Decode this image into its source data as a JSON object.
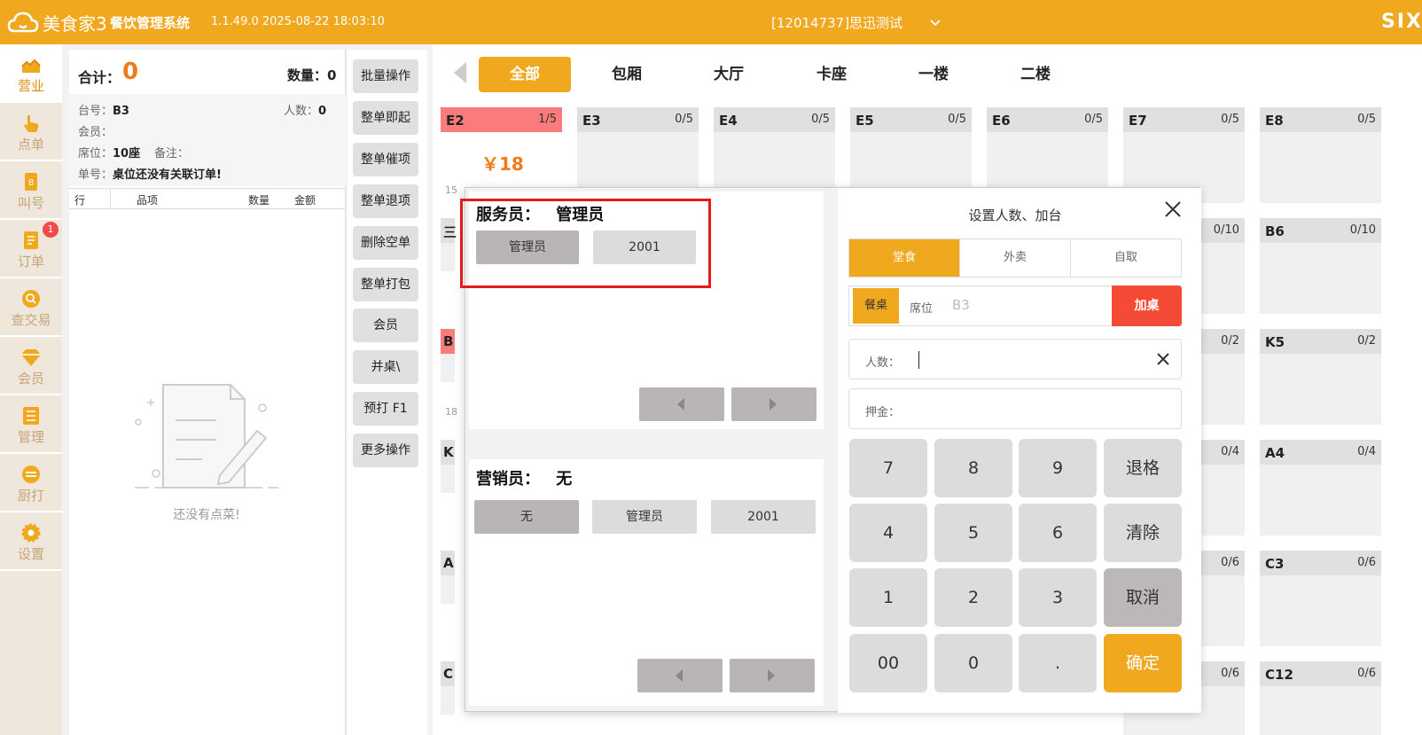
{
  "header": {
    "logo_text": "美食家3",
    "system_name": "餐饮管理系统",
    "version_time": "1.1.49.0 2025-08-22 18:03:10",
    "store": "[12014737]思迅测试",
    "brand": "SIX"
  },
  "nav": [
    {
      "label": "营业",
      "icon": "chart-icon"
    },
    {
      "label": "点单",
      "icon": "hand-icon"
    },
    {
      "label": "叫号",
      "icon": "number-icon"
    },
    {
      "label": "订单",
      "icon": "order-icon",
      "badge": "1"
    },
    {
      "label": "查交易",
      "icon": "search-icon"
    },
    {
      "label": "会员",
      "icon": "diamond-icon"
    },
    {
      "label": "管理",
      "icon": "list-icon"
    },
    {
      "label": "厨打",
      "icon": "kitchen-icon"
    },
    {
      "label": "设置",
      "icon": "gear-icon"
    }
  ],
  "order": {
    "total_label": "合计：",
    "total_value": "0",
    "qty_label": "数量：",
    "qty_value": "0",
    "table_label": "台号：",
    "table_value": "B3",
    "people_label": "人数：",
    "people_value": "0",
    "member_label": "会员：",
    "seat_label": "席位：",
    "seat_value": "10座",
    "remark_label": "备注：",
    "bill_label": "单号：",
    "bill_value": "桌位还没有关联订单!",
    "columns": [
      "行",
      "品项",
      "数量",
      "金额"
    ],
    "empty_text": "还没有点菜!"
  },
  "actions": [
    "批量操作",
    "整单即起",
    "整单催项",
    "整单退项",
    "删除空单",
    "整单打包",
    "会员",
    "并桌\\",
    "预打 F1",
    "更多操作"
  ],
  "areas": {
    "tabs": [
      "全部",
      "包厢",
      "大厅",
      "卡座",
      "一楼",
      "二楼"
    ],
    "active": "全部"
  },
  "tables": {
    "e2": {
      "name": "E2",
      "count": "1/5",
      "amount": "￥18"
    },
    "e3": {
      "name": "E3",
      "count": "0/5"
    },
    "e4": {
      "name": "E4",
      "count": "0/5"
    },
    "e5": {
      "name": "E5",
      "count": "0/5"
    },
    "e6": {
      "name": "E6",
      "count": "0/5"
    },
    "e7": {
      "name": "E7",
      "count": "0/5"
    },
    "e8": {
      "name": "E8",
      "count": "0/5"
    },
    "b6": {
      "name": "B6",
      "count": "0/10"
    },
    "k5": {
      "name": "K5",
      "count": "0/2"
    },
    "a4": {
      "name": "A4",
      "count": "0/4"
    },
    "c3": {
      "name": "C3",
      "count": "0/6"
    },
    "c12": {
      "name": "C12",
      "count": "0/6"
    },
    "col7_counts": [
      "0/10",
      "0/2",
      "0/4",
      "0/6",
      "0/6"
    ],
    "edge_labels": [
      "三",
      "B",
      "K",
      "A",
      "C"
    ],
    "edge_nums": [
      "15",
      "18"
    ]
  },
  "dialog": {
    "waiter_label": "服务员：",
    "waiter_value": "管理员",
    "waiter_options": [
      "管理员",
      "2001"
    ],
    "sales_label": "营销员：",
    "sales_value": "无",
    "sales_options": [
      "无",
      "管理员",
      "2001"
    ],
    "title": "设置人数、加台",
    "modes": [
      "堂食",
      "外卖",
      "自取"
    ],
    "seat_tag": "餐桌",
    "seat_label": "席位",
    "seat_value": "B3",
    "add_button": "加桌",
    "people_label": "人数：",
    "deposit_label": "押金：",
    "keys": [
      "7",
      "8",
      "9",
      "退格",
      "4",
      "5",
      "6",
      "清除",
      "1",
      "2",
      "3",
      "取消",
      "00",
      "0",
      ".",
      "确定"
    ]
  },
  "colors": {
    "accent": "#f0a81f",
    "busy": "#f97b7b",
    "danger": "#f54b36",
    "highlight": "#e31b1b"
  }
}
